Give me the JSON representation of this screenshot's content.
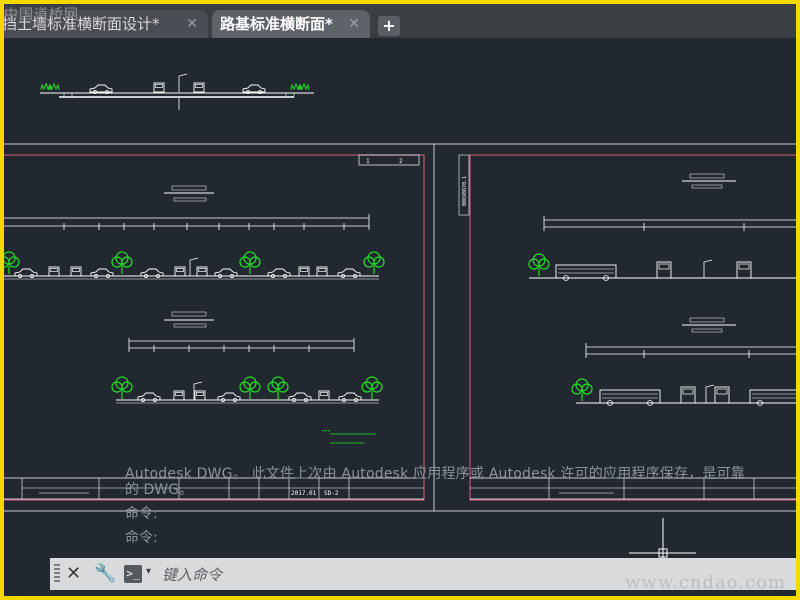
{
  "watermark_top": "中国道桥网",
  "watermark_bottom": "www.cndao.com",
  "tabs": [
    {
      "label": "挡土墙标准横断面设计*",
      "active": false
    },
    {
      "label": "路基标准横断面*",
      "active": true
    }
  ],
  "tab_close_glyph": "✕",
  "tab_add_glyph": "+",
  "drawing": {
    "left_sheet": {
      "title_block_cells": [
        "2017.01",
        "SD-2"
      ],
      "page_numbers": [
        "1",
        "2"
      ]
    },
    "right_sheet": {
      "side_label": "00690870.1"
    }
  },
  "command_history": {
    "line1": "Autodesk DWG。 此文件上次由 Autodesk 应用程序或 Autodesk 许可的应用程序保存，是可靠",
    "line1b": "的 DWG。",
    "line2": "命令:",
    "line3": "命令:"
  },
  "command_bar": {
    "close_glyph": "✕",
    "tool_glyph": "🔧",
    "prompt_glyph": ">_",
    "arrow_glyph": "▾",
    "placeholder": "键入命令"
  },
  "colors": {
    "canvas": "#212830",
    "frame": "#f5d800",
    "sheet_border": "#e0607e",
    "tree": "#22e022",
    "linework": "#ffffff"
  },
  "icons": [
    "close-icon",
    "plus-icon",
    "wrench-icon",
    "command-prompt-icon",
    "chevron-down-icon",
    "crosshair-icon",
    "tree-icon",
    "car-icon",
    "bus-icon"
  ]
}
